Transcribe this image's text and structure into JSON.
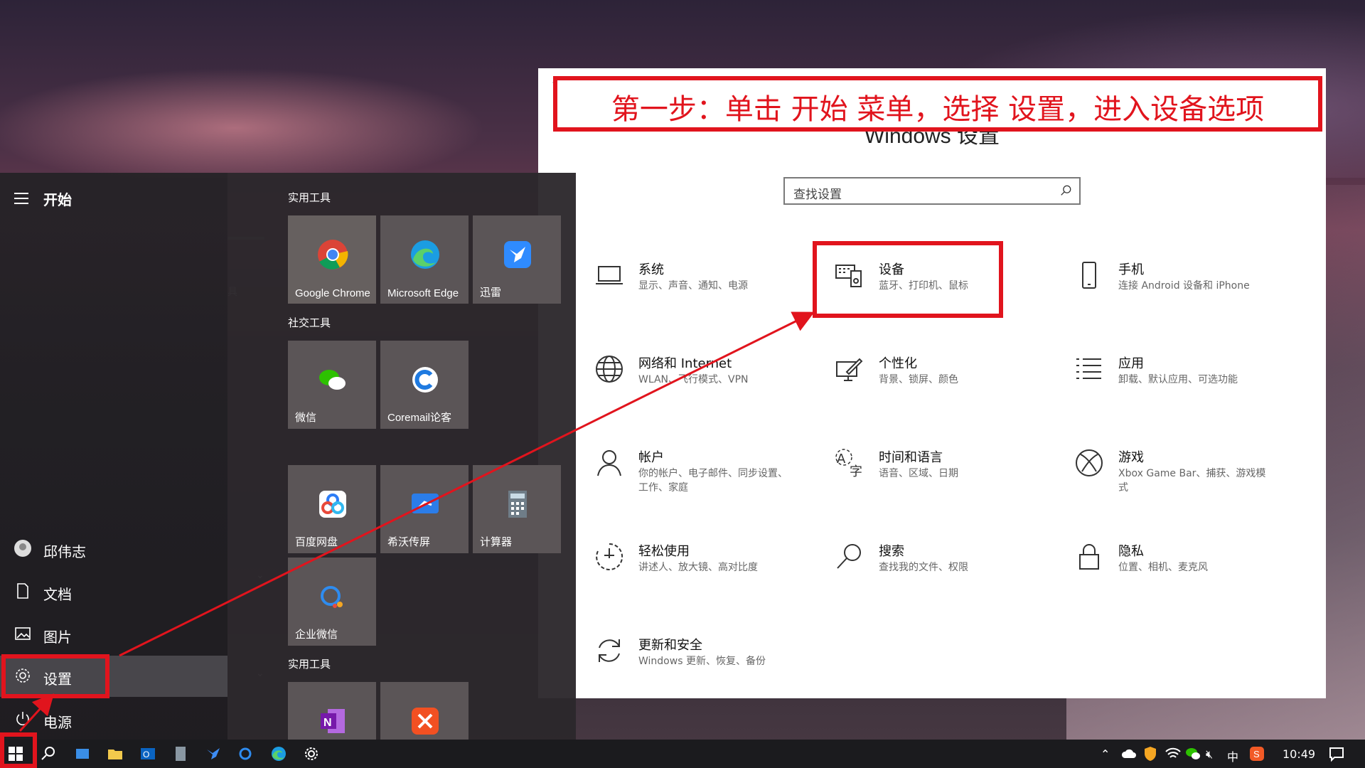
{
  "settings": {
    "window_title": "设置",
    "heading": "Windows 设置",
    "search_placeholder": "查找设置",
    "items": [
      {
        "title": "系统",
        "desc": "显示、声音、通知、电源"
      },
      {
        "title": "设备",
        "desc": "蓝牙、打印机、鼠标"
      },
      {
        "title": "手机",
        "desc": "连接 Android 设备和 iPhone"
      },
      {
        "title": "网络和 Internet",
        "desc": "WLAN、飞行模式、VPN"
      },
      {
        "title": "个性化",
        "desc": "背景、锁屏、颜色"
      },
      {
        "title": "应用",
        "desc": "卸载、默认应用、可选功能"
      },
      {
        "title": "帐户",
        "desc": "你的帐户、电子邮件、同步设置、工作、家庭"
      },
      {
        "title": "时间和语言",
        "desc": "语音、区域、日期"
      },
      {
        "title": "游戏",
        "desc": "Xbox Game Bar、捕获、游戏模式"
      },
      {
        "title": "轻松使用",
        "desc": "讲述人、放大镜、高对比度"
      },
      {
        "title": "搜索",
        "desc": "查找我的文件、权限"
      },
      {
        "title": "隐私",
        "desc": "位置、相机、麦克风"
      },
      {
        "title": "更新和安全",
        "desc": "Windows 更新、恢复、备份"
      }
    ]
  },
  "annotation": {
    "banner": "第一步：单击 开始 菜单，选择 设置，进入设备选项"
  },
  "start": {
    "title": "开始",
    "nav": [
      {
        "label": "邱伟志"
      },
      {
        "label": "文档"
      },
      {
        "label": "图片"
      },
      {
        "label": "设置"
      },
      {
        "label": "电源"
      }
    ],
    "mid_fragment": "具",
    "groups": [
      "实用工具",
      "社交工具",
      "实用工具"
    ],
    "tiles": [
      {
        "label": "Google Chrome"
      },
      {
        "label": "Microsoft Edge"
      },
      {
        "label": "迅雷"
      },
      {
        "label": "微信"
      },
      {
        "label": "Coremail论客"
      },
      {
        "label": "百度网盘"
      },
      {
        "label": "希沃传屏"
      },
      {
        "label": "计算器"
      },
      {
        "label": "企业微信"
      }
    ]
  },
  "taskbar": {
    "time": "10:49",
    "ime": "中"
  },
  "colors": {
    "annotation_red": "#e1141d"
  }
}
